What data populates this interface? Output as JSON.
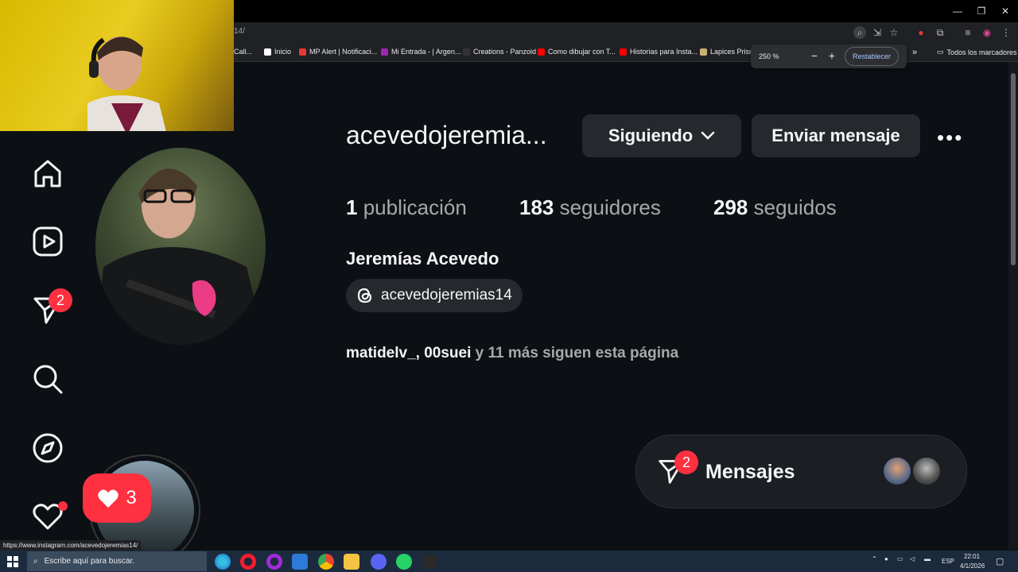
{
  "browser": {
    "url_fragment": "14/",
    "bookmarks": [
      {
        "label": "Call...",
        "color": "#4caf50"
      },
      {
        "label": "Inicio",
        "color": "#ffffff"
      },
      {
        "label": "MP Alert | Notificaci...",
        "color": "#e53935"
      },
      {
        "label": "Mi Entrada - | Argen...",
        "color": "#9c27b0"
      },
      {
        "label": "Creations - Panzoid",
        "color": "#333333"
      },
      {
        "label": "Como dibujar con T...",
        "color": "#ff0000"
      },
      {
        "label": "Historias para Insta...",
        "color": "#ff0000"
      },
      {
        "label": "Lapices Prisma",
        "color": "#c8b070"
      }
    ],
    "all_bookmarks": "Todos los marcadores",
    "more_bookmarks": "»",
    "zoom_level": "250 %",
    "zoom_minus": "−",
    "zoom_plus": "+",
    "reset_label": "Restablecer",
    "status_url": "https://www.instagram.com/acevedojeremias14/"
  },
  "nav": {
    "notification_badge": "2"
  },
  "profile": {
    "username": "acevedojeremia...",
    "following_label": "Siguiendo",
    "message_label": "Enviar mensaje",
    "more_label": "•••",
    "posts_count": "1",
    "posts_label": "publicación",
    "followers_count": "183",
    "followers_label": "seguidores",
    "following_count": "298",
    "following_stat_label": "seguidos",
    "full_name": "Jeremías Acevedo",
    "threads_handle": "acevedojeremias14",
    "followed_by_names": "matidelv_, 00suei",
    "followed_by_rest": " y 11 más siguen esta página"
  },
  "highlight": {
    "likes": "3"
  },
  "messages": {
    "label": "Mensajes",
    "badge": "2"
  },
  "taskbar": {
    "search_placeholder": "Escribe aquí para buscar.",
    "language": "ESP",
    "time": "22:01",
    "date": "4/1/2026"
  },
  "colors": {
    "accent_red": "#ff3040",
    "background": "#0c1014",
    "button_bg": "#25292e"
  }
}
